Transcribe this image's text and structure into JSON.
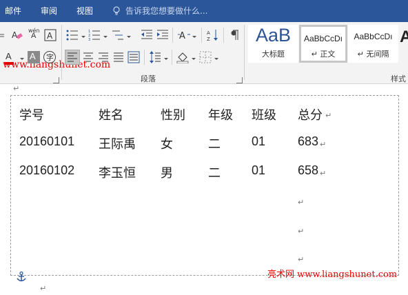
{
  "tabs": {
    "mail": "邮件",
    "review": "审阅",
    "view": "视图"
  },
  "tell_me": {
    "placeholder": "告诉我您想要做什么..."
  },
  "ribbon": {
    "paragraph_group_label": "段落",
    "styles_group_label": "样式",
    "styles": [
      {
        "sample": "AaB",
        "name": "大标题"
      },
      {
        "sample": "AaBbCcDı",
        "name": "↵ 正文"
      },
      {
        "sample": "AaBbCcDı",
        "name": "↵ 无间隔"
      }
    ],
    "phonetic_label": "wén",
    "enclose_label": "字"
  },
  "watermark": {
    "top": "www.liangshunet.com",
    "bottom": "亮术网 www.liangshunet.com"
  },
  "table": {
    "headers": [
      "学号",
      "姓名",
      "性别",
      "年级",
      "班级",
      "总分"
    ],
    "rows": [
      [
        "20160101",
        "王际禹",
        "女",
        "二",
        "01",
        "683"
      ],
      [
        "20160102",
        "李玉恒",
        "男",
        "二",
        "01",
        "658"
      ]
    ],
    "paragraph_mark": "↵"
  },
  "colors": {
    "tab_bar": "#2b579a",
    "ribbon_bg": "#f3f3f3",
    "font_color_red": "#e00000",
    "heading_blue": "#2f5496",
    "watermark_red": "#e00000"
  }
}
